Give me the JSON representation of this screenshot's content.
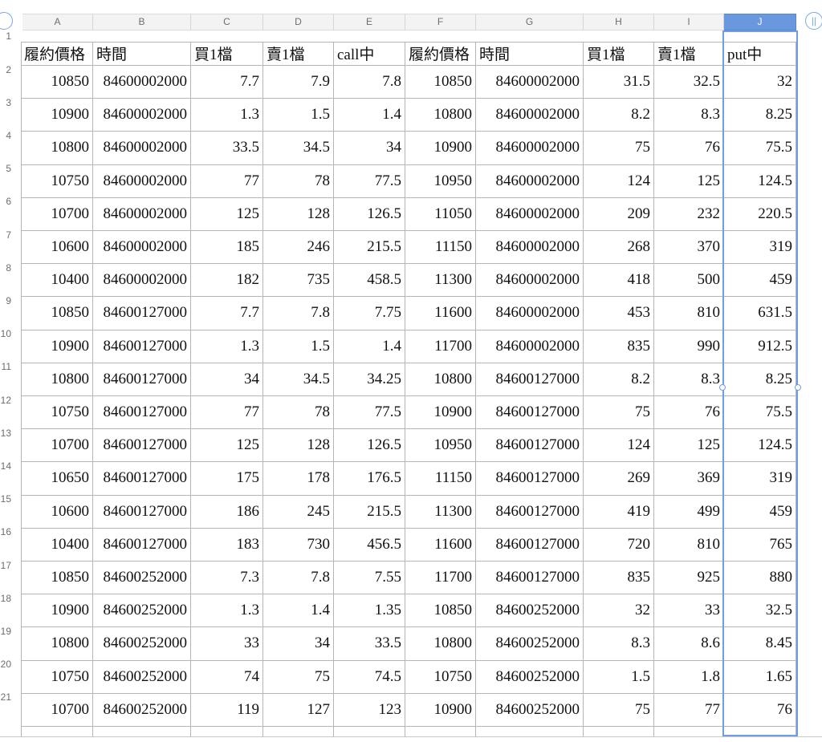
{
  "columns": [
    "A",
    "B",
    "C",
    "D",
    "E",
    "F",
    "G",
    "H",
    "I",
    "J"
  ],
  "selected_column": "J",
  "row_numbers": [
    "1",
    "2",
    "3",
    "4",
    "5",
    "6",
    "7",
    "8",
    "9",
    "10",
    "11",
    "12",
    "13",
    "14",
    "15",
    "16",
    "17",
    "18",
    "19",
    "20",
    "21"
  ],
  "header_row": [
    "履約價格",
    "時間",
    "買1檔",
    "賣1檔",
    "call中",
    "履約價格",
    "時間",
    "買1檔",
    "賣1檔",
    "put中"
  ],
  "rows": [
    [
      "10850",
      "84600002000",
      "7.7",
      "7.9",
      "7.8",
      "10850",
      "84600002000",
      "31.5",
      "32.5",
      "32"
    ],
    [
      "10900",
      "84600002000",
      "1.3",
      "1.5",
      "1.4",
      "10800",
      "84600002000",
      "8.2",
      "8.3",
      "8.25"
    ],
    [
      "10800",
      "84600002000",
      "33.5",
      "34.5",
      "34",
      "10900",
      "84600002000",
      "75",
      "76",
      "75.5"
    ],
    [
      "10750",
      "84600002000",
      "77",
      "78",
      "77.5",
      "10950",
      "84600002000",
      "124",
      "125",
      "124.5"
    ],
    [
      "10700",
      "84600002000",
      "125",
      "128",
      "126.5",
      "11050",
      "84600002000",
      "209",
      "232",
      "220.5"
    ],
    [
      "10600",
      "84600002000",
      "185",
      "246",
      "215.5",
      "11150",
      "84600002000",
      "268",
      "370",
      "319"
    ],
    [
      "10400",
      "84600002000",
      "182",
      "735",
      "458.5",
      "11300",
      "84600002000",
      "418",
      "500",
      "459"
    ],
    [
      "10850",
      "84600127000",
      "7.7",
      "7.8",
      "7.75",
      "11600",
      "84600002000",
      "453",
      "810",
      "631.5"
    ],
    [
      "10900",
      "84600127000",
      "1.3",
      "1.5",
      "1.4",
      "11700",
      "84600002000",
      "835",
      "990",
      "912.5"
    ],
    [
      "10800",
      "84600127000",
      "34",
      "34.5",
      "34.25",
      "10800",
      "84600127000",
      "8.2",
      "8.3",
      "8.25"
    ],
    [
      "10750",
      "84600127000",
      "77",
      "78",
      "77.5",
      "10900",
      "84600127000",
      "75",
      "76",
      "75.5"
    ],
    [
      "10700",
      "84600127000",
      "125",
      "128",
      "126.5",
      "10950",
      "84600127000",
      "124",
      "125",
      "124.5"
    ],
    [
      "10650",
      "84600127000",
      "175",
      "178",
      "176.5",
      "11150",
      "84600127000",
      "269",
      "369",
      "319"
    ],
    [
      "10600",
      "84600127000",
      "186",
      "245",
      "215.5",
      "11300",
      "84600127000",
      "419",
      "499",
      "459"
    ],
    [
      "10400",
      "84600127000",
      "183",
      "730",
      "456.5",
      "11600",
      "84600127000",
      "720",
      "810",
      "765"
    ],
    [
      "10850",
      "84600252000",
      "7.3",
      "7.8",
      "7.55",
      "11700",
      "84600127000",
      "835",
      "925",
      "880"
    ],
    [
      "10900",
      "84600252000",
      "1.3",
      "1.4",
      "1.35",
      "10850",
      "84600252000",
      "32",
      "33",
      "32.5"
    ],
    [
      "10800",
      "84600252000",
      "33",
      "34",
      "33.5",
      "10800",
      "84600252000",
      "8.3",
      "8.6",
      "8.45"
    ],
    [
      "10750",
      "84600252000",
      "74",
      "75",
      "74.5",
      "10750",
      "84600252000",
      "1.5",
      "1.8",
      "1.65"
    ],
    [
      "10700",
      "84600252000",
      "119",
      "127",
      "123",
      "10900",
      "84600252000",
      "75",
      "77",
      "76"
    ]
  ],
  "icons": {
    "top_left": "select-all-icon",
    "top_right": "freeze-pane-icon"
  },
  "colors": {
    "selection": "#6f9ee6",
    "header_bg": "#f3f3f3",
    "grid": "#b5b5b5"
  }
}
